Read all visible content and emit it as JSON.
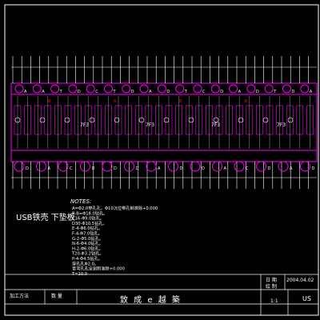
{
  "drawing": {
    "part_name": "USB铁壳   下垫板",
    "notes_title": "NOTES:",
    "notes": [
      "A=Φ2.0穿孔孔，Φ10沉位带孔制准除+0.000",
      "B-B=Φ18.0钻孔。",
      "C16-Φ9.0钻孔。",
      "D30-Φ10.5钻孔。",
      "E-4-Φ6.0钻孔。",
      "F-4-Φ7.0钻孔。",
      "G-2-Φ5.0钻孔。",
      "N-6-Φ4.0钻孔。",
      "H-2-Φ6.0钻孔。",
      "T20-Φ3.2钻孔。",
      "P-4-Φ4.5钻孔。",
      "穿孔孔Φ2.0。",
      "音弯孔孔全割制准除+0.000",
      "T=10.0"
    ],
    "title_block": {
      "company": "致 成 e 越 築",
      "date_label": "日  期",
      "date_value": "2004.04.02",
      "drawn_label": "绘  制",
      "process_label": "加工方法",
      "qty_label": "数  量",
      "scale_label": "1:1",
      "drawing_no": "US"
    },
    "hole_labels_top": [
      "A",
      "A",
      "T",
      "D",
      "C",
      "T",
      "D",
      "A",
      "D",
      "T",
      "C",
      "D",
      "A",
      "D",
      "T",
      "D",
      "A"
    ],
    "hole_labels_bottom": [
      "D",
      "A",
      "C",
      "D",
      "D",
      "D",
      "A",
      "D",
      "D",
      "A",
      "C",
      "D",
      "A",
      "D"
    ],
    "mid_labels": [
      "7F3",
      "7F3",
      "7F3",
      "7F3"
    ],
    "small_marks": [
      "B",
      "B",
      "B",
      "B"
    ]
  },
  "colors": {
    "background": "#000000",
    "frame": "#ffffff",
    "geometry": "#ff00ff",
    "dimension": "#ffffff",
    "hole": "#ff00ff",
    "accent_red": "#ff0000"
  }
}
